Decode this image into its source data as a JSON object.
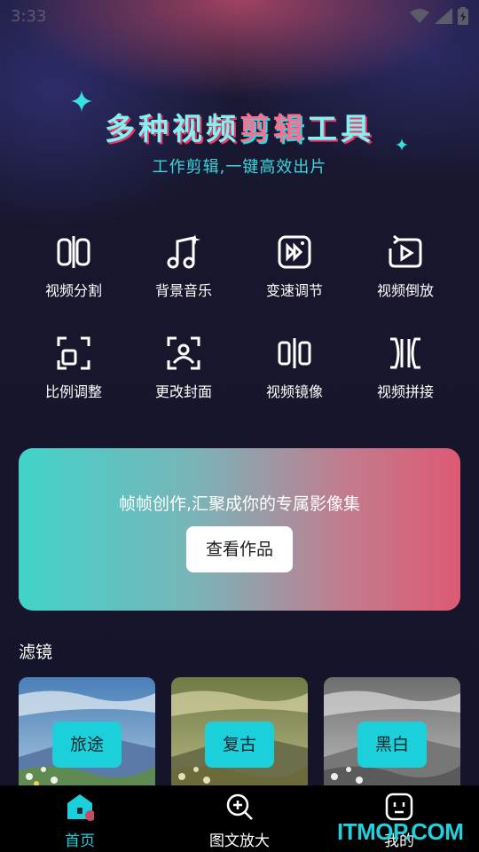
{
  "status_bar": {
    "time": "3:33"
  },
  "hero": {
    "title_a": "多种视频",
    "title_b": "剪辑",
    "title_c": "工具",
    "subtitle": "工作剪辑,一键高效出片"
  },
  "tools": [
    {
      "label": "视频分割",
      "icon": "split-icon"
    },
    {
      "label": "背景音乐",
      "icon": "music-note-icon"
    },
    {
      "label": "变速调节",
      "icon": "speed-icon"
    },
    {
      "label": "视频倒放",
      "icon": "rewind-play-icon"
    },
    {
      "label": "比例调整",
      "icon": "crop-ratio-icon"
    },
    {
      "label": "更改封面",
      "icon": "cover-image-icon"
    },
    {
      "label": "视频镜像",
      "icon": "mirror-icon"
    },
    {
      "label": "视频拼接",
      "icon": "join-icon"
    }
  ],
  "banner": {
    "text": "帧帧创作,汇聚成你的专属影像集",
    "button": "查看作品"
  },
  "filters": {
    "title": "滤镜",
    "items": [
      {
        "label": "旅途",
        "style": "natural"
      },
      {
        "label": "复古",
        "style": "vintage"
      },
      {
        "label": "黑白",
        "style": "monochrome"
      }
    ]
  },
  "tabbar": {
    "items": [
      {
        "label": "首页",
        "icon": "home-icon",
        "active": true
      },
      {
        "label": "图文放大",
        "icon": "zoom-in-icon",
        "active": false
      },
      {
        "label": "我的",
        "icon": "profile-face-icon",
        "active": false
      }
    ]
  },
  "watermark": "ITMOP.COM",
  "colors": {
    "accent": "#1bd0da",
    "active_tab": "#1bd0da",
    "inactive_tab": "#ffffff",
    "background": "#15142a"
  }
}
